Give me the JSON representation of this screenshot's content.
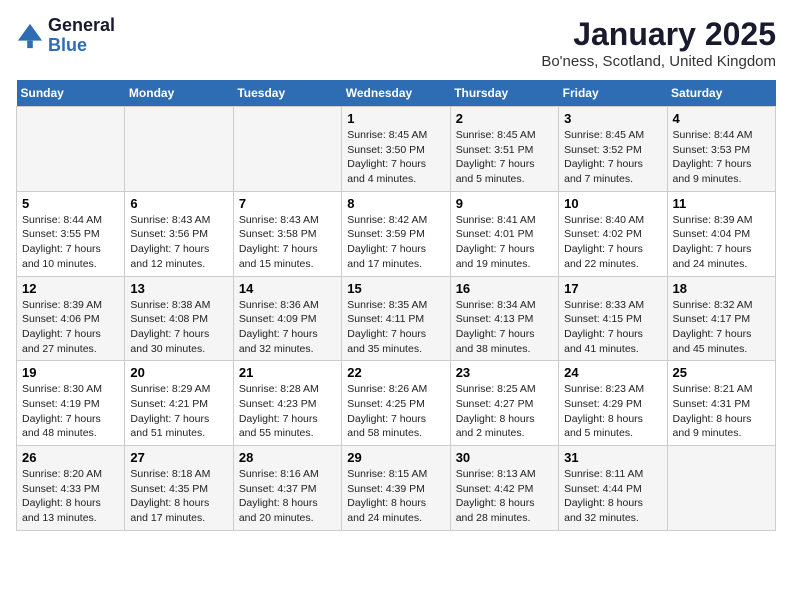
{
  "header": {
    "logo_general": "General",
    "logo_blue": "Blue",
    "month_title": "January 2025",
    "location": "Bo'ness, Scotland, United Kingdom"
  },
  "weekdays": [
    "Sunday",
    "Monday",
    "Tuesday",
    "Wednesday",
    "Thursday",
    "Friday",
    "Saturday"
  ],
  "weeks": [
    [
      {
        "day": "",
        "sunrise": "",
        "sunset": "",
        "daylight": ""
      },
      {
        "day": "",
        "sunrise": "",
        "sunset": "",
        "daylight": ""
      },
      {
        "day": "",
        "sunrise": "",
        "sunset": "",
        "daylight": ""
      },
      {
        "day": "1",
        "sunrise": "Sunrise: 8:45 AM",
        "sunset": "Sunset: 3:50 PM",
        "daylight": "Daylight: 7 hours and 4 minutes."
      },
      {
        "day": "2",
        "sunrise": "Sunrise: 8:45 AM",
        "sunset": "Sunset: 3:51 PM",
        "daylight": "Daylight: 7 hours and 5 minutes."
      },
      {
        "day": "3",
        "sunrise": "Sunrise: 8:45 AM",
        "sunset": "Sunset: 3:52 PM",
        "daylight": "Daylight: 7 hours and 7 minutes."
      },
      {
        "day": "4",
        "sunrise": "Sunrise: 8:44 AM",
        "sunset": "Sunset: 3:53 PM",
        "daylight": "Daylight: 7 hours and 9 minutes."
      }
    ],
    [
      {
        "day": "5",
        "sunrise": "Sunrise: 8:44 AM",
        "sunset": "Sunset: 3:55 PM",
        "daylight": "Daylight: 7 hours and 10 minutes."
      },
      {
        "day": "6",
        "sunrise": "Sunrise: 8:43 AM",
        "sunset": "Sunset: 3:56 PM",
        "daylight": "Daylight: 7 hours and 12 minutes."
      },
      {
        "day": "7",
        "sunrise": "Sunrise: 8:43 AM",
        "sunset": "Sunset: 3:58 PM",
        "daylight": "Daylight: 7 hours and 15 minutes."
      },
      {
        "day": "8",
        "sunrise": "Sunrise: 8:42 AM",
        "sunset": "Sunset: 3:59 PM",
        "daylight": "Daylight: 7 hours and 17 minutes."
      },
      {
        "day": "9",
        "sunrise": "Sunrise: 8:41 AM",
        "sunset": "Sunset: 4:01 PM",
        "daylight": "Daylight: 7 hours and 19 minutes."
      },
      {
        "day": "10",
        "sunrise": "Sunrise: 8:40 AM",
        "sunset": "Sunset: 4:02 PM",
        "daylight": "Daylight: 7 hours and 22 minutes."
      },
      {
        "day": "11",
        "sunrise": "Sunrise: 8:39 AM",
        "sunset": "Sunset: 4:04 PM",
        "daylight": "Daylight: 7 hours and 24 minutes."
      }
    ],
    [
      {
        "day": "12",
        "sunrise": "Sunrise: 8:39 AM",
        "sunset": "Sunset: 4:06 PM",
        "daylight": "Daylight: 7 hours and 27 minutes."
      },
      {
        "day": "13",
        "sunrise": "Sunrise: 8:38 AM",
        "sunset": "Sunset: 4:08 PM",
        "daylight": "Daylight: 7 hours and 30 minutes."
      },
      {
        "day": "14",
        "sunrise": "Sunrise: 8:36 AM",
        "sunset": "Sunset: 4:09 PM",
        "daylight": "Daylight: 7 hours and 32 minutes."
      },
      {
        "day": "15",
        "sunrise": "Sunrise: 8:35 AM",
        "sunset": "Sunset: 4:11 PM",
        "daylight": "Daylight: 7 hours and 35 minutes."
      },
      {
        "day": "16",
        "sunrise": "Sunrise: 8:34 AM",
        "sunset": "Sunset: 4:13 PM",
        "daylight": "Daylight: 7 hours and 38 minutes."
      },
      {
        "day": "17",
        "sunrise": "Sunrise: 8:33 AM",
        "sunset": "Sunset: 4:15 PM",
        "daylight": "Daylight: 7 hours and 41 minutes."
      },
      {
        "day": "18",
        "sunrise": "Sunrise: 8:32 AM",
        "sunset": "Sunset: 4:17 PM",
        "daylight": "Daylight: 7 hours and 45 minutes."
      }
    ],
    [
      {
        "day": "19",
        "sunrise": "Sunrise: 8:30 AM",
        "sunset": "Sunset: 4:19 PM",
        "daylight": "Daylight: 7 hours and 48 minutes."
      },
      {
        "day": "20",
        "sunrise": "Sunrise: 8:29 AM",
        "sunset": "Sunset: 4:21 PM",
        "daylight": "Daylight: 7 hours and 51 minutes."
      },
      {
        "day": "21",
        "sunrise": "Sunrise: 8:28 AM",
        "sunset": "Sunset: 4:23 PM",
        "daylight": "Daylight: 7 hours and 55 minutes."
      },
      {
        "day": "22",
        "sunrise": "Sunrise: 8:26 AM",
        "sunset": "Sunset: 4:25 PM",
        "daylight": "Daylight: 7 hours and 58 minutes."
      },
      {
        "day": "23",
        "sunrise": "Sunrise: 8:25 AM",
        "sunset": "Sunset: 4:27 PM",
        "daylight": "Daylight: 8 hours and 2 minutes."
      },
      {
        "day": "24",
        "sunrise": "Sunrise: 8:23 AM",
        "sunset": "Sunset: 4:29 PM",
        "daylight": "Daylight: 8 hours and 5 minutes."
      },
      {
        "day": "25",
        "sunrise": "Sunrise: 8:21 AM",
        "sunset": "Sunset: 4:31 PM",
        "daylight": "Daylight: 8 hours and 9 minutes."
      }
    ],
    [
      {
        "day": "26",
        "sunrise": "Sunrise: 8:20 AM",
        "sunset": "Sunset: 4:33 PM",
        "daylight": "Daylight: 8 hours and 13 minutes."
      },
      {
        "day": "27",
        "sunrise": "Sunrise: 8:18 AM",
        "sunset": "Sunset: 4:35 PM",
        "daylight": "Daylight: 8 hours and 17 minutes."
      },
      {
        "day": "28",
        "sunrise": "Sunrise: 8:16 AM",
        "sunset": "Sunset: 4:37 PM",
        "daylight": "Daylight: 8 hours and 20 minutes."
      },
      {
        "day": "29",
        "sunrise": "Sunrise: 8:15 AM",
        "sunset": "Sunset: 4:39 PM",
        "daylight": "Daylight: 8 hours and 24 minutes."
      },
      {
        "day": "30",
        "sunrise": "Sunrise: 8:13 AM",
        "sunset": "Sunset: 4:42 PM",
        "daylight": "Daylight: 8 hours and 28 minutes."
      },
      {
        "day": "31",
        "sunrise": "Sunrise: 8:11 AM",
        "sunset": "Sunset: 4:44 PM",
        "daylight": "Daylight: 8 hours and 32 minutes."
      },
      {
        "day": "",
        "sunrise": "",
        "sunset": "",
        "daylight": ""
      }
    ]
  ]
}
